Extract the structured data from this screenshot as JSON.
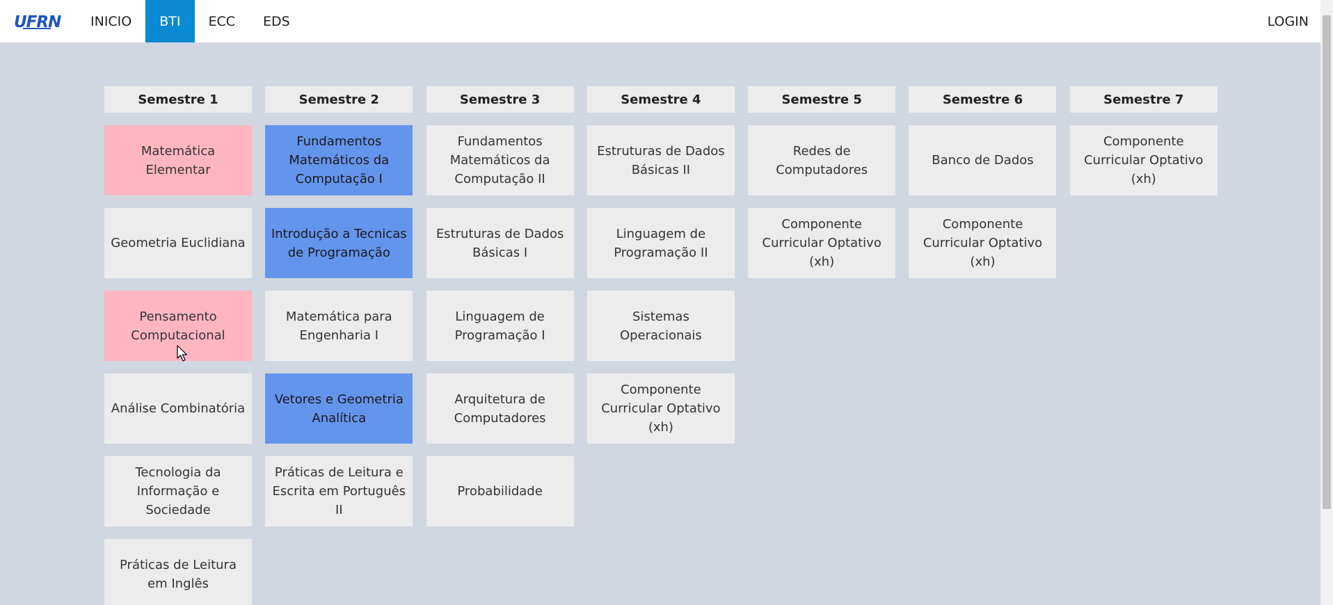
{
  "nav": {
    "items": [
      {
        "label": "INICIO",
        "active": false
      },
      {
        "label": "BTI",
        "active": true
      },
      {
        "label": "ECC",
        "active": false
      },
      {
        "label": "EDS",
        "active": false
      }
    ],
    "login": "LOGIN",
    "logo_text": "UFRN"
  },
  "colors": {
    "accent": "#0a8ad4",
    "pink": "#ffb6c1",
    "blue": "#6495ed",
    "card": "#ececec",
    "background": "#d0d7e0"
  },
  "semesters": [
    {
      "title": "Semestre 1",
      "courses": [
        {
          "name": "Matemática Elementar",
          "state": "pink"
        },
        {
          "name": "Geometria Euclidiana",
          "state": "default"
        },
        {
          "name": "Pensamento Computacional",
          "state": "pink"
        },
        {
          "name": "Análise Combinatória",
          "state": "default"
        },
        {
          "name": "Tecnologia da Informação e Sociedade",
          "state": "default"
        },
        {
          "name": "Práticas de Leitura em Inglês",
          "state": "default"
        }
      ]
    },
    {
      "title": "Semestre 2",
      "courses": [
        {
          "name": "Fundamentos Matemáticos da Computação I",
          "state": "blue"
        },
        {
          "name": "Introdução a Tecnicas de Programação",
          "state": "blue"
        },
        {
          "name": "Matemática para Engenharia I",
          "state": "default"
        },
        {
          "name": "Vetores e Geometria Analítica",
          "state": "blue"
        },
        {
          "name": "Práticas de Leitura e Escrita em Português II",
          "state": "default"
        }
      ]
    },
    {
      "title": "Semestre 3",
      "courses": [
        {
          "name": "Fundamentos Matemáticos da Computação II",
          "state": "default"
        },
        {
          "name": "Estruturas de Dados Básicas I",
          "state": "default"
        },
        {
          "name": "Linguagem de Programação I",
          "state": "default"
        },
        {
          "name": "Arquitetura de Computadores",
          "state": "default"
        },
        {
          "name": "Probabilidade",
          "state": "default"
        }
      ]
    },
    {
      "title": "Semestre 4",
      "courses": [
        {
          "name": "Estruturas de Dados Básicas II",
          "state": "default"
        },
        {
          "name": "Linguagem de Programação II",
          "state": "default"
        },
        {
          "name": "Sistemas Operacionais",
          "state": "default"
        },
        {
          "name": "Componente Curricular Optativo (xh)",
          "state": "default"
        }
      ]
    },
    {
      "title": "Semestre 5",
      "courses": [
        {
          "name": "Redes de Computadores",
          "state": "default"
        },
        {
          "name": "Componente Curricular Optativo (xh)",
          "state": "default"
        }
      ]
    },
    {
      "title": "Semestre 6",
      "courses": [
        {
          "name": "Banco de Dados",
          "state": "default"
        },
        {
          "name": "Componente Curricular Optativo (xh)",
          "state": "default"
        }
      ]
    },
    {
      "title": "Semestre 7",
      "courses": [
        {
          "name": "Componente Curricular Optativo (xh)",
          "state": "default"
        }
      ]
    }
  ]
}
